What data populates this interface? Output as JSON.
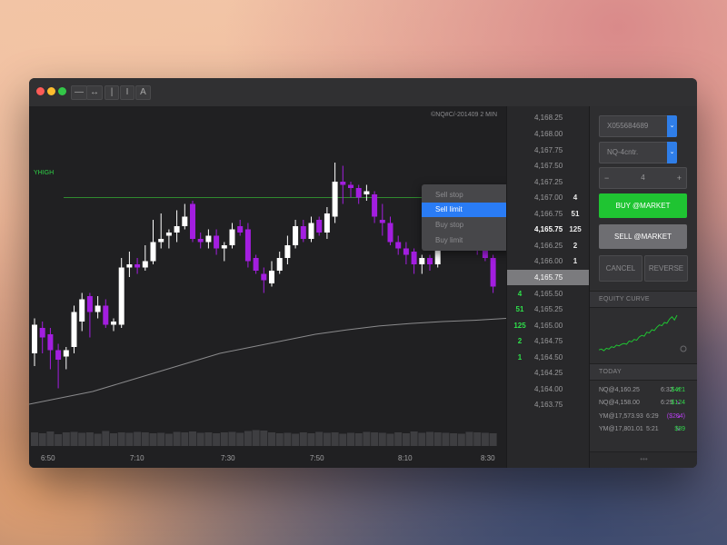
{
  "toolbar": {
    "tools": [
      "—",
      "↔",
      "|",
      "I",
      "A"
    ]
  },
  "chart": {
    "symbol_label": "©NQ#C/-201409 2 MIN",
    "yhigh_label": "YHIGH",
    "x_ticks": [
      "6:50",
      "7:10",
      "7:30",
      "7:50",
      "8:10",
      "8:30"
    ],
    "colors": {
      "up": "#ffffff",
      "down": "#a31ee0",
      "yhigh": "#2f8a2f",
      "ma": "#8a8a8c",
      "bg": "#202022"
    }
  },
  "chart_data": {
    "type": "candlestick",
    "title": "©NQ#C/-201409 2 MIN",
    "x_ticks": [
      "6:50",
      "7:10",
      "7:30",
      "7:50",
      "8:10",
      "8:30"
    ],
    "y_range": [
      4163.5,
      4168.5
    ],
    "yhigh": 4167.0,
    "candles": [
      {
        "o": 4164.55,
        "c": 4165.0,
        "h": 4165.1,
        "l": 4164.35
      },
      {
        "o": 4164.95,
        "c": 4164.8,
        "h": 4165.05,
        "l": 4164.55
      },
      {
        "o": 4164.85,
        "c": 4164.6,
        "h": 4164.95,
        "l": 4164.3
      },
      {
        "o": 4164.6,
        "c": 4164.45,
        "h": 4164.7,
        "l": 4164.0
      },
      {
        "o": 4164.5,
        "c": 4164.6,
        "h": 4164.65,
        "l": 4164.3
      },
      {
        "o": 4164.65,
        "c": 4165.2,
        "h": 4165.3,
        "l": 4164.55
      },
      {
        "o": 4165.05,
        "c": 4165.4,
        "h": 4165.5,
        "l": 4164.9
      },
      {
        "o": 4165.45,
        "c": 4165.2,
        "h": 4165.5,
        "l": 4164.8
      },
      {
        "o": 4165.2,
        "c": 4165.3,
        "h": 4165.45,
        "l": 4165.1
      },
      {
        "o": 4165.3,
        "c": 4165.0,
        "h": 4165.4,
        "l": 4164.95
      },
      {
        "o": 4165.0,
        "c": 4165.05,
        "h": 4165.1,
        "l": 4164.9
      },
      {
        "o": 4165.0,
        "c": 4165.9,
        "h": 4166.05,
        "l": 4164.95
      },
      {
        "o": 4165.9,
        "c": 4165.95,
        "h": 4166.15,
        "l": 4165.75
      },
      {
        "o": 4165.95,
        "c": 4165.9,
        "h": 4166.05,
        "l": 4165.8
      },
      {
        "o": 4165.9,
        "c": 4166.0,
        "h": 4166.25,
        "l": 4165.85
      },
      {
        "o": 4166.0,
        "c": 4166.3,
        "h": 4166.65,
        "l": 4165.95
      },
      {
        "o": 4166.3,
        "c": 4166.35,
        "h": 4166.75,
        "l": 4166.2
      },
      {
        "o": 4166.4,
        "c": 4166.45,
        "h": 4166.5,
        "l": 4166.2
      },
      {
        "o": 4166.45,
        "c": 4166.55,
        "h": 4166.8,
        "l": 4166.3
      },
      {
        "o": 4166.55,
        "c": 4166.7,
        "h": 4166.9,
        "l": 4166.5
      },
      {
        "o": 4166.9,
        "c": 4166.35,
        "h": 4166.95,
        "l": 4166.3
      },
      {
        "o": 4166.35,
        "c": 4166.3,
        "h": 4166.45,
        "l": 4166.2
      },
      {
        "o": 4166.3,
        "c": 4166.4,
        "h": 4166.5,
        "l": 4166.2
      },
      {
        "o": 4166.4,
        "c": 4166.2,
        "h": 4166.5,
        "l": 4166.1
      },
      {
        "o": 4166.2,
        "c": 4166.25,
        "h": 4166.3,
        "l": 4166.0
      },
      {
        "o": 4166.25,
        "c": 4166.5,
        "h": 4166.6,
        "l": 4166.2
      },
      {
        "o": 4166.55,
        "c": 4166.45,
        "h": 4166.65,
        "l": 4166.4
      },
      {
        "o": 4166.5,
        "c": 4166.0,
        "h": 4166.6,
        "l": 4165.9
      },
      {
        "o": 4166.05,
        "c": 4165.85,
        "h": 4166.1,
        "l": 4165.8
      },
      {
        "o": 4165.8,
        "c": 4165.7,
        "h": 4165.9,
        "l": 4165.5
      },
      {
        "o": 4165.65,
        "c": 4165.85,
        "h": 4166.0,
        "l": 4165.6
      },
      {
        "o": 4165.85,
        "c": 4166.05,
        "h": 4166.15,
        "l": 4165.8
      },
      {
        "o": 4166.05,
        "c": 4166.25,
        "h": 4166.4,
        "l": 4165.95
      },
      {
        "o": 4166.25,
        "c": 4166.55,
        "h": 4166.65,
        "l": 4166.2
      },
      {
        "o": 4166.55,
        "c": 4166.35,
        "h": 4166.65,
        "l": 4166.3
      },
      {
        "o": 4166.35,
        "c": 4166.6,
        "h": 4166.7,
        "l": 4166.3
      },
      {
        "o": 4166.65,
        "c": 4166.45,
        "h": 4166.7,
        "l": 4166.4
      },
      {
        "o": 4166.45,
        "c": 4166.75,
        "h": 4166.85,
        "l": 4166.35
      },
      {
        "o": 4166.7,
        "c": 4167.25,
        "h": 4167.55,
        "l": 4166.6
      },
      {
        "o": 4167.25,
        "c": 4167.2,
        "h": 4167.5,
        "l": 4166.9
      },
      {
        "o": 4167.2,
        "c": 4167.15,
        "h": 4167.25,
        "l": 4167.0
      },
      {
        "o": 4167.15,
        "c": 4167.0,
        "h": 4167.2,
        "l": 4166.9
      },
      {
        "o": 4167.05,
        "c": 4167.1,
        "h": 4167.2,
        "l": 4166.95
      },
      {
        "o": 4167.05,
        "c": 4166.7,
        "h": 4167.1,
        "l": 4166.6
      },
      {
        "o": 4166.65,
        "c": 4166.6,
        "h": 4166.9,
        "l": 4166.4
      },
      {
        "o": 4166.6,
        "c": 4166.3,
        "h": 4166.7,
        "l": 4166.25
      },
      {
        "o": 4166.3,
        "c": 4166.2,
        "h": 4166.4,
        "l": 4166.1
      },
      {
        "o": 4166.2,
        "c": 4166.1,
        "h": 4166.3,
        "l": 4165.95
      },
      {
        "o": 4166.15,
        "c": 4165.95,
        "h": 4166.2,
        "l": 4165.8
      },
      {
        "o": 4165.95,
        "c": 4166.05,
        "h": 4166.1,
        "l": 4165.8
      },
      {
        "o": 4166.05,
        "c": 4165.95,
        "h": 4166.1,
        "l": 4165.85
      },
      {
        "o": 4165.95,
        "c": 4166.35,
        "h": 4166.7,
        "l": 4165.9
      },
      {
        "o": 4166.4,
        "c": 4166.5,
        "h": 4166.6,
        "l": 4166.3
      },
      {
        "o": 4166.55,
        "c": 4166.45,
        "h": 4166.7,
        "l": 4166.4
      },
      {
        "o": 4166.45,
        "c": 4166.65,
        "h": 4166.75,
        "l": 4166.4
      },
      {
        "o": 4166.6,
        "c": 4166.4,
        "h": 4166.65,
        "l": 4166.3
      },
      {
        "o": 4166.3,
        "c": 4166.2,
        "h": 4166.4,
        "l": 4166.1
      },
      {
        "o": 4166.2,
        "c": 4166.05,
        "h": 4166.3,
        "l": 4166.0
      },
      {
        "o": 4166.05,
        "c": 4165.6,
        "h": 4166.1,
        "l": 4165.5
      }
    ],
    "ma_line": [
      4163.75,
      4163.85,
      4163.95,
      4164.1,
      4164.25,
      4164.4,
      4164.55,
      4164.65,
      4164.75,
      4164.85,
      4164.92,
      4164.98,
      4165.02,
      4165.05,
      4165.07,
      4165.1
    ],
    "volume": [
      30,
      28,
      32,
      26,
      30,
      31,
      29,
      30,
      27,
      33,
      28,
      30,
      29,
      31,
      30,
      28,
      29,
      27,
      31,
      30,
      32,
      29,
      30,
      28,
      30,
      31,
      29,
      33,
      35,
      34,
      30,
      28,
      29,
      27,
      30,
      28,
      31,
      29,
      30,
      27,
      29,
      28,
      31,
      30,
      29,
      27,
      30,
      28,
      32,
      29,
      31,
      30,
      29,
      28,
      27,
      31,
      30,
      29,
      28
    ],
    "yhigh_label": "YHIGH",
    "grid": false
  },
  "context_menu": {
    "items": [
      {
        "label": "Sell stop",
        "shortcut": "⌘Q"
      },
      {
        "label": "Sell limit",
        "shortcut": "⌘A"
      },
      {
        "label": "Buy stop",
        "shortcut": "⌘E"
      },
      {
        "label": "Buy limit",
        "shortcut": "⌘D"
      }
    ]
  },
  "dom": {
    "rows": [
      {
        "price": "4,168.25",
        "left": "",
        "right": ""
      },
      {
        "price": "4,168.00",
        "left": "",
        "right": ""
      },
      {
        "price": "4,167.75",
        "left": "",
        "right": ""
      },
      {
        "price": "4,167.50",
        "left": "",
        "right": ""
      },
      {
        "price": "4,167.25",
        "left": "",
        "right": ""
      },
      {
        "price": "4,167.00",
        "left": "",
        "right": "4"
      },
      {
        "price": "4,166.75",
        "left": "",
        "right": "51"
      },
      {
        "price": "4,165.75",
        "left": "",
        "right": "125"
      },
      {
        "price": "4,166.25",
        "left": "",
        "right": "2"
      },
      {
        "price": "4,166.00",
        "left": "",
        "right": "1"
      },
      {
        "price": "4,165.75",
        "left": "",
        "right": ""
      },
      {
        "price": "4,165.50",
        "left": "4",
        "right": ""
      },
      {
        "price": "4,165.25",
        "left": "51",
        "right": ""
      },
      {
        "price": "4,165.00",
        "left": "125",
        "right": ""
      },
      {
        "price": "4,164.75",
        "left": "2",
        "right": ""
      },
      {
        "price": "4,164.50",
        "left": "1",
        "right": ""
      },
      {
        "price": "4,164.25",
        "left": "",
        "right": ""
      },
      {
        "price": "4,164.00",
        "left": "",
        "right": ""
      },
      {
        "price": "4,163.75",
        "left": "",
        "right": ""
      }
    ]
  },
  "side": {
    "account": "X055684689",
    "contract": "NQ-4cntr.",
    "qty": "4",
    "minus": "−",
    "plus": "+",
    "buy": "BUY @MARKET",
    "sell": "SELL @MARKET",
    "cancel": "CANCEL",
    "reverse": "REVERSE",
    "equity_label": "EQUITY CURVE",
    "today_label": "TODAY",
    "equity_curve": [
      2,
      3,
      1,
      4,
      3,
      6,
      5,
      8,
      7,
      9,
      10,
      9,
      13,
      12,
      15,
      14,
      18,
      20,
      19,
      24,
      23,
      27,
      26,
      30,
      33,
      32,
      36,
      35,
      40,
      43,
      39,
      45
    ],
    "trades": [
      {
        "label": "NQ@4,160.25",
        "time": "6:32",
        "dir": "up",
        "pnl": "$421",
        "color": "#32d74b"
      },
      {
        "label": "NQ@4,158.00",
        "time": "6:29",
        "dir": "down",
        "pnl": "$124",
        "color": "#32d74b"
      },
      {
        "label": "YM@17,573.93",
        "time": "6:29",
        "dir": "down",
        "pnl": "($204)",
        "color": "#b23ee8"
      },
      {
        "label": "YM@17,801.01",
        "time": "5:21",
        "dir": "down",
        "pnl": "$89",
        "color": "#32d74b"
      }
    ],
    "colors": {
      "buy": "#1fc432",
      "sell": "#6e6e72",
      "accent": "#2f7ee8"
    }
  }
}
